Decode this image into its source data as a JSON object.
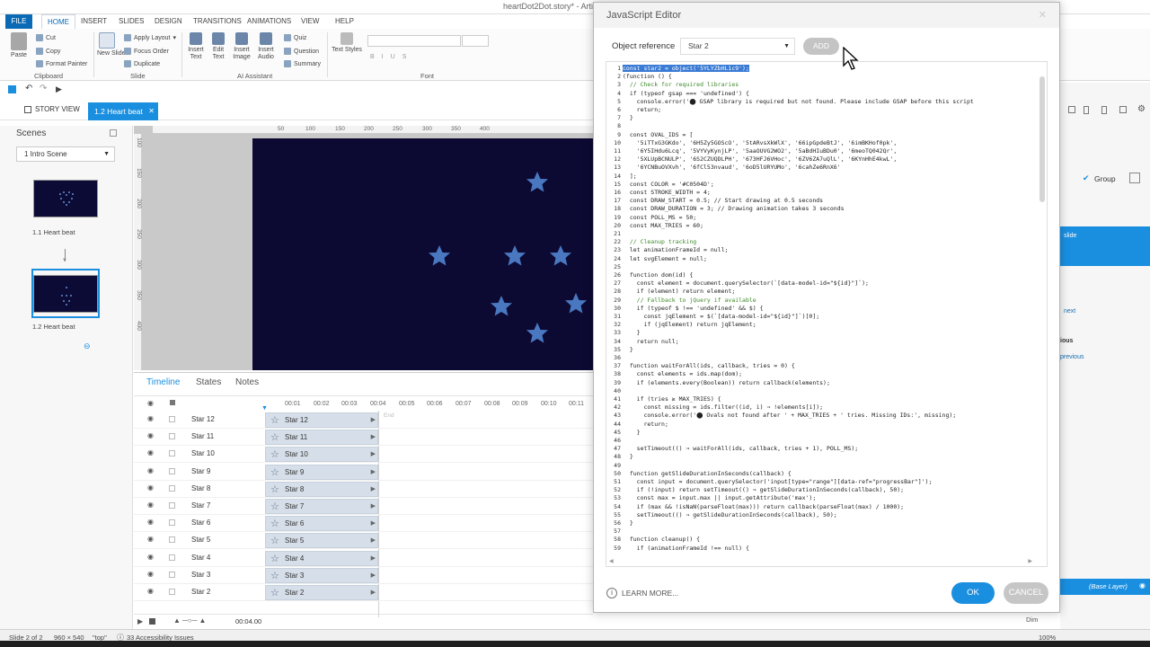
{
  "window": {
    "title": "heartDot2Dot.story* - Articu"
  },
  "ribbon": {
    "tabs": [
      "FILE",
      "HOME",
      "INSERT",
      "SLIDES",
      "DESIGN",
      "TRANSITIONS",
      "ANIMATIONS",
      "VIEW",
      "HELP"
    ],
    "paste": "Paste",
    "cut": "Cut",
    "copy": "Copy",
    "format_painter": "Format Painter",
    "clipboard_group": "Clipboard",
    "new_slide": "New Slide",
    "apply_layout": "Apply Layout",
    "focus_order": "Focus Order",
    "duplicate": "Duplicate",
    "slide_group": "Slide",
    "insert_text": "Insert Text",
    "edit_text": "Edit Text",
    "insert_image": "Insert Image",
    "insert_audio": "Insert Audio",
    "quiz": "Quiz",
    "question": "Question",
    "summary": "Summary",
    "ai_group": "AI Assistant",
    "text_styles": "Text Styles",
    "font_group": "Font"
  },
  "view_tabs": {
    "story_view": "STORY VIEW",
    "slide_tab": "1.2 Heart beat"
  },
  "scenes": {
    "title": "Scenes",
    "selected": "1 Intro Scene",
    "slides": [
      {
        "label": "1.1 Heart beat"
      },
      {
        "label": "1.2 Heart beat"
      }
    ]
  },
  "rulers": {
    "top": [
      "50",
      "100",
      "150",
      "200",
      "250",
      "300",
      "350",
      "400"
    ],
    "left": [
      "100",
      "150",
      "200",
      "250",
      "300",
      "350",
      "400"
    ]
  },
  "stage": {
    "star_color": "#4a78c0",
    "stars": 10
  },
  "timeline": {
    "tabs": [
      "Timeline",
      "States",
      "Notes"
    ],
    "ticks": [
      "00:01",
      "00:02",
      "00:03",
      "00:04",
      "00:05",
      "00:06",
      "00:07",
      "00:08",
      "00:09",
      "00:10",
      "00:11"
    ],
    "end_label": "End",
    "rows": [
      "Star 12",
      "Star 11",
      "Star 10",
      "Star 9",
      "Star 8",
      "Star 7",
      "Star 6",
      "Star 5",
      "Star 4",
      "Star 3",
      "Star 2"
    ],
    "duration": "00:04.00"
  },
  "status": {
    "slide": "Slide 2 of 2",
    "dims": "960 × 540",
    "state": "\"top\"",
    "accessibility": "33 Accessibility Issues",
    "zoom": "100%",
    "dim_label": "Dim"
  },
  "right_panel": {
    "group": "Group",
    "slide_link": "slide",
    "next": "next",
    "previous_label": "ious",
    "previous_link": "previous",
    "base_layer": "(Base Layer)"
  },
  "dialog": {
    "title": "JavaScript Editor",
    "object_reference_label": "Object reference",
    "object_reference_value": "Star 2",
    "add_label": "ADD",
    "learn_more": "LEARN MORE...",
    "ok": "OK",
    "cancel": "CANCEL",
    "code_lines": [
      {
        "n": "1",
        "t": "const star2 = object('5YLYZbHL1c9');",
        "hl": true
      },
      {
        "n": "2",
        "t": "(function () {"
      },
      {
        "n": "3",
        "t": "  // Check for required libraries",
        "cm": true
      },
      {
        "n": "4",
        "t": "  if (typeof gsap === 'undefined') {"
      },
      {
        "n": "5",
        "t": "    console.error('⬤ GSAP library is required but not found. Please include GSAP before this script"
      },
      {
        "n": "6",
        "t": "    return;"
      },
      {
        "n": "7",
        "t": "  }"
      },
      {
        "n": "8",
        "t": ""
      },
      {
        "n": "9",
        "t": "  const OVAL_IDS = ["
      },
      {
        "n": "10",
        "t": "    '5iTTxG3GKdo', '6H5Zy5GOScO', '5tARvsXkWlX', '66ipGpdeBtJ', '6imBKHof0pk',"
      },
      {
        "n": "11",
        "t": "    '6Y5IHdu6Lcq', '5VYVyKynjLP', '5aaOUVG2WO2', '5aBdHIuBDu0', '6meoTQ042Qr',"
      },
      {
        "n": "12",
        "t": "    '5XLUpBCNULP', '6S2CZUQDLPH', '673HFJ6VHoc', '6ZV6ZA7uQlL', '6KYnHhE4kwL',"
      },
      {
        "n": "13",
        "t": "    '6YCNBuOVXvh', '6fCl53nvaud', '6oD5lURYUMo', '6cahZe6RnX6'"
      },
      {
        "n": "14",
        "t": "  ];"
      },
      {
        "n": "15",
        "t": "  const COLOR = '#C0504D';"
      },
      {
        "n": "16",
        "t": "  const STROKE_WIDTH = 4;"
      },
      {
        "n": "17",
        "t": "  const DRAW_START = 0.5; // Start drawing at 0.5 seconds"
      },
      {
        "n": "18",
        "t": "  const DRAW_DURATION = 3; // Drawing animation takes 3 seconds"
      },
      {
        "n": "19",
        "t": "  const POLL_MS = 50;"
      },
      {
        "n": "20",
        "t": "  const MAX_TRIES = 60;"
      },
      {
        "n": "21",
        "t": ""
      },
      {
        "n": "22",
        "t": "  // Cleanup tracking",
        "cm": true
      },
      {
        "n": "23",
        "t": "  let animationFrameId = null;"
      },
      {
        "n": "24",
        "t": "  let svgElement = null;"
      },
      {
        "n": "25",
        "t": ""
      },
      {
        "n": "26",
        "t": "  function dom(id) {"
      },
      {
        "n": "27",
        "t": "    const element = document.querySelector(`[data-model-id=\"${id}\"]`);"
      },
      {
        "n": "28",
        "t": "    if (element) return element;"
      },
      {
        "n": "29",
        "t": "    // Fallback to jQuery if available",
        "cm": true
      },
      {
        "n": "30",
        "t": "    if (typeof $ !== 'undefined' && $) {"
      },
      {
        "n": "31",
        "t": "      const jqElement = $(`[data-model-id=\"${id}\"]`)[0];"
      },
      {
        "n": "32",
        "t": "      if (jqElement) return jqElement;"
      },
      {
        "n": "33",
        "t": "    }"
      },
      {
        "n": "34",
        "t": "    return null;"
      },
      {
        "n": "35",
        "t": "  }"
      },
      {
        "n": "36",
        "t": ""
      },
      {
        "n": "37",
        "t": "  function waitForAll(ids, callback, tries = 0) {"
      },
      {
        "n": "38",
        "t": "    const elements = ids.map(dom);"
      },
      {
        "n": "39",
        "t": "    if (elements.every(Boolean)) return callback(elements);"
      },
      {
        "n": "40",
        "t": ""
      },
      {
        "n": "41",
        "t": "    if (tries ≥ MAX_TRIES) {"
      },
      {
        "n": "42",
        "t": "      const missing = ids.filter((id, i) ⇒ !elements[i]);"
      },
      {
        "n": "43",
        "t": "      console.error('⬤ Ovals not found after ' + MAX_TRIES + ' tries. Missing IDs:', missing);"
      },
      {
        "n": "44",
        "t": "      return;"
      },
      {
        "n": "45",
        "t": "    }"
      },
      {
        "n": "46",
        "t": ""
      },
      {
        "n": "47",
        "t": "    setTimeout(() ⇒ waitForAll(ids, callback, tries + 1), POLL_MS);"
      },
      {
        "n": "48",
        "t": "  }"
      },
      {
        "n": "49",
        "t": ""
      },
      {
        "n": "50",
        "t": "  function getSlideDurationInSeconds(callback) {"
      },
      {
        "n": "51",
        "t": "    const input = document.querySelector('input[type=\"range\"][data-ref=\"progressBar\"]');"
      },
      {
        "n": "52",
        "t": "    if (!input) return setTimeout(() ⇒ getSlideDurationInSeconds(callback), 50);"
      },
      {
        "n": "53",
        "t": "    const max = input.max || input.getAttribute('max');"
      },
      {
        "n": "54",
        "t": "    if (max && !isNaN(parseFloat(max))) return callback(parseFloat(max) / 1000);"
      },
      {
        "n": "55",
        "t": "    setTimeout(() ⇒ getSlideDurationInSeconds(callback), 50);"
      },
      {
        "n": "56",
        "t": "  }"
      },
      {
        "n": "57",
        "t": ""
      },
      {
        "n": "58",
        "t": "  function cleanup() {"
      },
      {
        "n": "59",
        "t": "    if (animationFrameId !== null) {"
      }
    ]
  }
}
